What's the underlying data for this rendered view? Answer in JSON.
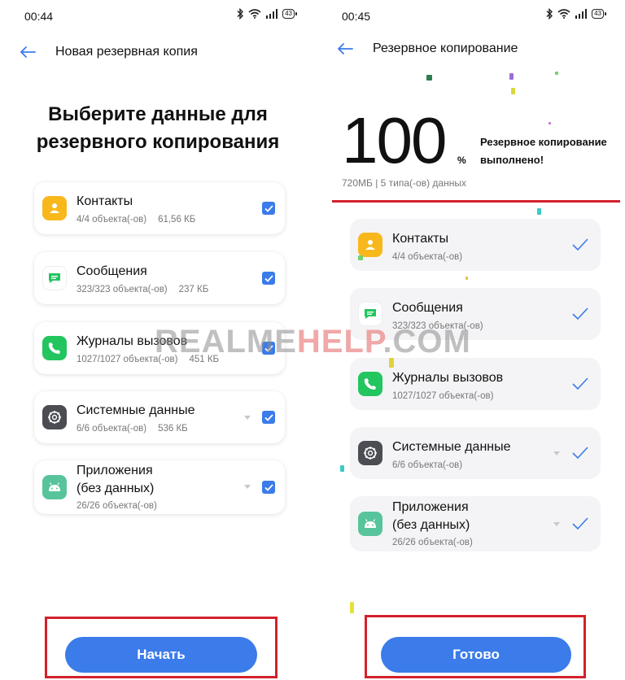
{
  "left": {
    "status": {
      "time": "00:44",
      "battery": "43"
    },
    "title": "Новая резервная копия",
    "headline_line1": "Выберите данные для",
    "headline_line2": "резервного копирования",
    "items": [
      {
        "name": "Контакты",
        "count": "4/4 объекта(-ов)",
        "size": "61,56 КБ",
        "icon": "contacts-icon"
      },
      {
        "name": "Сообщения",
        "count": "323/323 объекта(-ов)",
        "size": "237 КБ",
        "icon": "messages-icon"
      },
      {
        "name": "Журналы вызовов",
        "count": "1027/1027 объекта(-ов)",
        "size": "451 КБ",
        "icon": "phone-icon"
      },
      {
        "name": "Системные данные",
        "count": "6/6 объекта(-ов)",
        "size": "536 КБ",
        "icon": "settings-gear-icon"
      },
      {
        "name_line1": "Приложения",
        "name_line2": "(без данных)",
        "count": "26/26 объекта(-ов)",
        "icon": "android-icon"
      }
    ],
    "button_label": "Начать"
  },
  "right": {
    "status": {
      "time": "00:45",
      "battery": "43"
    },
    "title": "Резервное копирование",
    "percent": "100",
    "percent_sign": "%",
    "done_line1": "Резервное копирование",
    "done_line2": "выполнено!",
    "meta": "720МБ  | 5 типа(-ов) данных",
    "items": [
      {
        "name": "Контакты",
        "count": "4/4 объекта(-ов)",
        "icon": "contacts-icon"
      },
      {
        "name": "Сообщения",
        "count": "323/323 объекта(-ов)",
        "icon": "messages-icon"
      },
      {
        "name": "Журналы вызовов",
        "count": "1027/1027 объекта(-ов)",
        "icon": "phone-icon"
      },
      {
        "name": "Системные данные",
        "count": "6/6 объекта(-ов)",
        "icon": "settings-gear-icon"
      },
      {
        "name_line1": "Приложения",
        "name_line2": "(без данных)",
        "count": "26/26 объекта(-ов)",
        "icon": "android-icon"
      }
    ],
    "button_label": "Готово"
  },
  "watermark": {
    "part1": "REALME",
    "part2": "HELP",
    "part3": ".COM"
  },
  "colors": {
    "accent": "#3b7bea",
    "highlight": "#d3212b",
    "contacts": "#f8b81c",
    "phone": "#22c55e",
    "apps": "#58c49b",
    "system": "#4b4d52"
  }
}
